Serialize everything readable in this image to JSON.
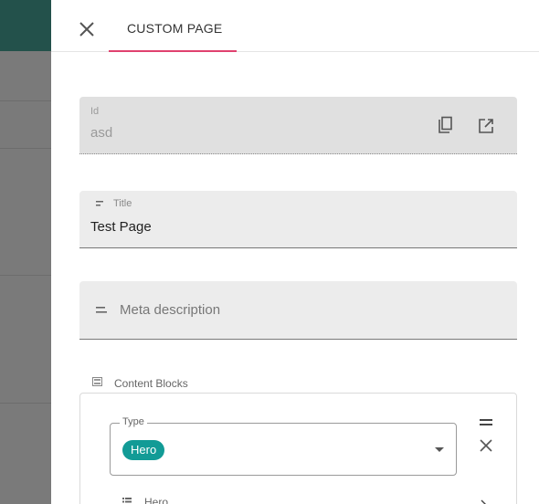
{
  "tab": {
    "label": "CUSTOM PAGE",
    "accent_color": "#e0416f"
  },
  "fields": {
    "id": {
      "label": "Id",
      "value": "asd"
    },
    "title": {
      "label": "Title",
      "value": "Test Page"
    },
    "meta_description": {
      "placeholder": "Meta description",
      "value": ""
    }
  },
  "content_blocks": {
    "label": "Content Blocks",
    "items": [
      {
        "type_legend": "Type",
        "type_value": "Hero",
        "chip_color": "#129b96",
        "subsection_label": "Hero"
      }
    ]
  },
  "icons": {
    "close": "close-icon",
    "copy": "copy-icon",
    "open_external": "open-in-new-icon",
    "title_field": "short-text-icon",
    "meta_field": "short-text-icon",
    "content_blocks": "view-list-icon",
    "drag": "drag-handle-icon",
    "remove": "close-icon",
    "hero": "list-icon",
    "expand": "chevron-right-icon"
  }
}
